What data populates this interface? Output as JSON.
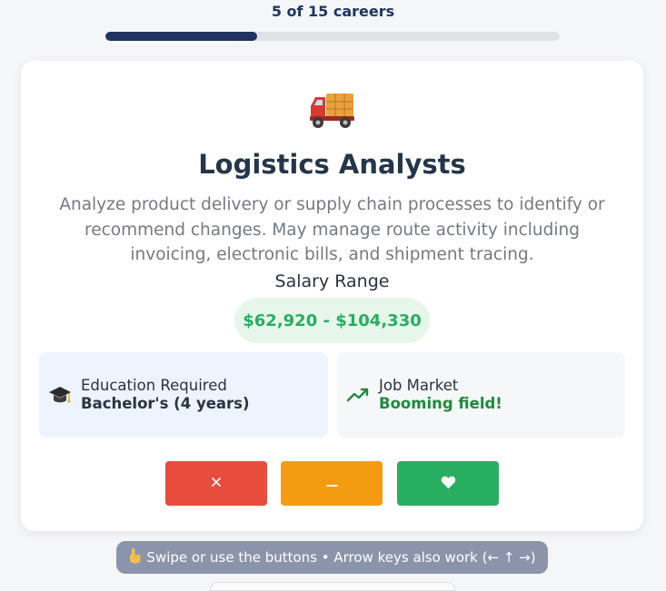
{
  "progress": {
    "label": "5 of 15 careers",
    "current": 5,
    "total": 15,
    "fill_fraction": 0.333
  },
  "career": {
    "icon": "delivery-truck-icon",
    "title": "Logistics Analysts",
    "description": "Analyze product delivery or supply chain processes to identify or recommend changes. May manage route activity including invoicing, electronic bills, and shipment tracing.",
    "salary_label": "Salary Range",
    "salary_range": "$62,920 - $104,330",
    "education": {
      "icon": "graduation-cap-icon",
      "label": "Education Required",
      "value": "Bachelor's (4 years)"
    },
    "job_market": {
      "icon": "trending-up-icon",
      "label": "Job Market",
      "value": "Booming field!"
    }
  },
  "actions": {
    "reject": {
      "symbol": "×",
      "icon": "close-icon"
    },
    "maybe": {
      "symbol": "−",
      "icon": "minus-icon"
    },
    "like": {
      "icon": "heart-icon"
    }
  },
  "hint": {
    "text": "Swipe or use the buttons • Arrow keys also work (← ↑ →)",
    "icon": "pointing-hand-icon"
  },
  "colors": {
    "progress_fill": "#1f3461",
    "reject": "#e74c3c",
    "maybe": "#f39c12",
    "like": "#27ae60",
    "salary_text": "#27ae60",
    "booming_text": "#1e8a3c"
  }
}
